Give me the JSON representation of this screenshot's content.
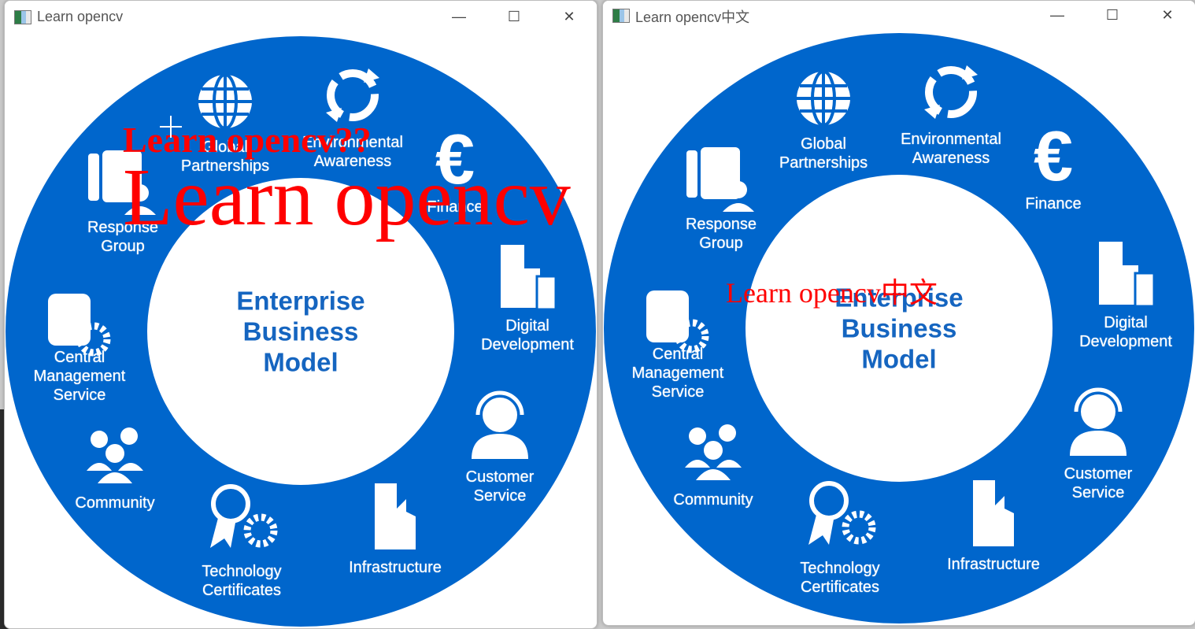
{
  "colors": {
    "ring": "#0066cc",
    "center_text": "#1565c0",
    "overlay_text": "#ff0000"
  },
  "windows": [
    {
      "title": "Learn opencv",
      "controls": {
        "minimize": "—",
        "maximize": "☐",
        "close": "✕"
      },
      "overlays": [
        "Learn opencv??",
        "Learn opencv"
      ]
    },
    {
      "title": "Learn opencv中文",
      "controls": {
        "minimize": "—",
        "maximize": "☐",
        "close": "✕"
      },
      "overlays": [
        "Learn opencv中文"
      ]
    }
  ],
  "diagram": {
    "center_title": "Enterprise\nBusiness\nModel",
    "segments": [
      {
        "label": "Global\nPartnerships",
        "icon": "globe-icon"
      },
      {
        "label": "Environmental\nAwareness",
        "icon": "recycle-icon"
      },
      {
        "label": "Finance",
        "icon": "euro-icon"
      },
      {
        "label": "Digital\nDevelopment",
        "icon": "building-server-icon"
      },
      {
        "label": "Customer\nService",
        "icon": "headset-icon"
      },
      {
        "label": "Infrastructure",
        "icon": "building-icon"
      },
      {
        "label": "Technology\nCertificates",
        "icon": "badge-gear-icon"
      },
      {
        "label": "Community",
        "icon": "people-icon"
      },
      {
        "label": "Central\nManagement\nService",
        "icon": "database-gear-icon"
      },
      {
        "label": "Response\nGroup",
        "icon": "phone-user-icon"
      }
    ]
  }
}
